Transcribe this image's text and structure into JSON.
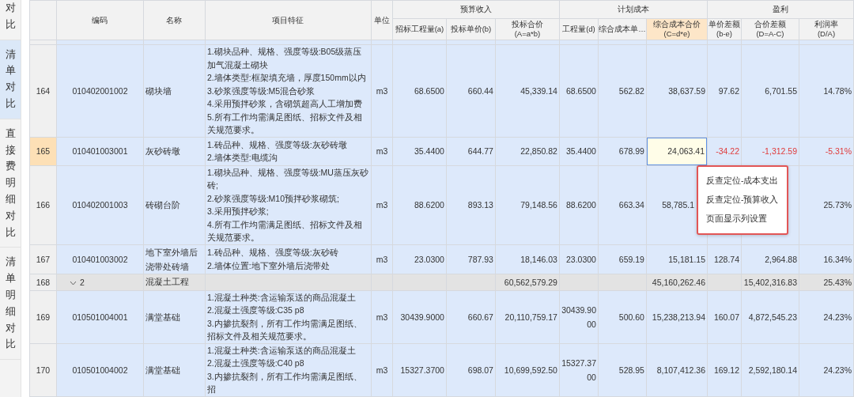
{
  "sidebar": {
    "tabs": [
      {
        "label": "对比",
        "selected": false
      },
      {
        "label": "清单对比",
        "selected": true
      },
      {
        "label": "直接费明细对比",
        "selected": false
      },
      {
        "label": "清单明细对比",
        "selected": false
      }
    ]
  },
  "table": {
    "fixed_columns": [
      "编码",
      "名称",
      "项目特征",
      "单位"
    ],
    "column_groups": [
      {
        "label": "预算收入",
        "columns": [
          {
            "lines": [
              "招标工程量(a)"
            ],
            "highlighted": false
          },
          {
            "lines": [
              "投标单价(b)"
            ],
            "highlighted": false
          },
          {
            "lines": [
              "投标合价",
              "(A=a*b)"
            ],
            "highlighted": false
          }
        ]
      },
      {
        "label": "计划成本",
        "columns": [
          {
            "lines": [
              "工程量(d)"
            ],
            "highlighted": false
          },
          {
            "lines": [
              "综合成本单…"
            ],
            "highlighted": false
          },
          {
            "lines": [
              "综合成本合价",
              "(C=d*e)"
            ],
            "highlighted": true
          }
        ]
      },
      {
        "label": "盈利",
        "columns": [
          {
            "lines": [
              "单价差额",
              "(b-e)"
            ],
            "highlighted": false
          },
          {
            "lines": [
              "合价差额",
              "(D=A-C)"
            ],
            "highlighted": false
          },
          {
            "lines": [
              "利润率",
              "(D/A)"
            ],
            "highlighted": false
          }
        ]
      }
    ],
    "rows": [
      {
        "kind": "item",
        "number": "164",
        "code": "010402001002",
        "name": "砌块墙",
        "features": [
          "1.砌块品种、规格、强度等级:B05级蒸压加气混凝土砌块",
          "2.墙体类型:框架填充墙，厚度150mm以内",
          "3.砂浆强度等级:M5混合砂浆",
          "4.采用预拌砂浆，含砌筑超高人工增加费",
          "5.所有工作均需满足图纸、招标文件及相关规范要求。"
        ],
        "unit": "m3",
        "values": {
          "bid_qty": "68.6500",
          "bid_price": "660.44",
          "bid_total": "45,339.14",
          "cost_qty": "68.6500",
          "cost_unit_price": "562.82",
          "cost_total": "38,637.59",
          "unit_diff": "97.62",
          "total_diff": "6,701.55",
          "profit_rate": "14.78%"
        },
        "selected": false,
        "loss": false
      },
      {
        "kind": "item",
        "number": "165",
        "code": "010401003001",
        "name": "灰砂砖墩",
        "features": [
          "1.砖品种、规格、强度等级:灰砂砖墩",
          "2.墙体类型:电缆沟"
        ],
        "unit": "m3",
        "values": {
          "bid_qty": "35.4400",
          "bid_price": "644.77",
          "bid_total": "22,850.82",
          "cost_qty": "35.4400",
          "cost_unit_price": "678.99",
          "cost_total": "24,063.41",
          "unit_diff": "-34.22",
          "total_diff": "-1,312.59",
          "profit_rate": "-5.31%"
        },
        "selected": true,
        "loss": true
      },
      {
        "kind": "item",
        "number": "166",
        "code": "010402001003",
        "name": "砖砌台阶",
        "features": [
          "1.砌块品种、规格、强度等级:MU蒸压灰砂砖;",
          "2.砂浆强度等级:M10预拌砂浆砌筑;",
          "3.采用预拌砂浆;",
          "4.所有工作均需满足图纸、招标文件及相关规范要求。"
        ],
        "unit": "m3",
        "values": {
          "bid_qty": "88.6200",
          "bid_price": "893.13",
          "bid_total": "79,148.56",
          "cost_qty": "88.6200",
          "cost_unit_price": "663.34",
          "cost_total": "58,785.1",
          "profit_rate": "25.73%"
        },
        "selected": false,
        "loss": false
      },
      {
        "kind": "item",
        "number": "167",
        "code": "010401003002",
        "name": "地下室外墙后浇带处砖墙",
        "features": [
          "1.砖品种、规格、强度等级:灰砂砖",
          "2.墙体位置:地下室外墙后浇带处"
        ],
        "unit": "m3",
        "values": {
          "bid_qty": "23.0300",
          "bid_price": "787.93",
          "bid_total": "18,146.03",
          "cost_qty": "23.0300",
          "cost_unit_price": "659.19",
          "cost_total": "15,181.15",
          "unit_diff": "128.74",
          "total_diff": "2,964.88",
          "profit_rate": "16.34%"
        },
        "selected": false,
        "loss": false
      },
      {
        "kind": "group",
        "number": "168",
        "code": "2",
        "name": "混凝土工程",
        "expanded": true,
        "values": {
          "bid_total": "60,562,579.29",
          "cost_total": "45,160,262.46",
          "total_diff": "15,402,316.83",
          "profit_rate": "25.43%"
        },
        "selected": false,
        "loss": false
      },
      {
        "kind": "item",
        "number": "169",
        "code": "010501004001",
        "name": "满堂基础",
        "features": [
          "1.混凝土种类:含运输泵送的商品混凝土",
          "2.混凝土强度等级:C35 p8",
          "3.内掺抗裂剂，所有工作均需满足图纸、招标文件及相关规范要求。"
        ],
        "unit": "m3",
        "values": {
          "bid_qty": "30439.9000",
          "bid_price": "660.67",
          "bid_total": "20,110,759.17",
          "cost_qty": "30439.9000",
          "cost_unit_price": "500.60",
          "cost_total": "15,238,213.94",
          "unit_diff": "160.07",
          "total_diff": "4,872,545.23",
          "profit_rate": "24.23%"
        },
        "selected": false,
        "loss": false
      },
      {
        "kind": "item",
        "number": "170",
        "code": "010501004002",
        "name": "满堂基础",
        "features": [
          "1.混凝土种类:含运输泵送的商品混凝土",
          "2.混凝土强度等级:C40 p8",
          "3.内掺抗裂剂，所有工作均需满足图纸、招"
        ],
        "unit": "m3",
        "values": {
          "bid_qty": "15327.3700",
          "bid_price": "698.07",
          "bid_total": "10,699,592.50",
          "cost_qty": "15327.3700",
          "cost_unit_price": "528.95",
          "cost_total": "8,107,412.36",
          "unit_diff": "169.12",
          "total_diff": "2,592,180.14",
          "profit_rate": "24.23%"
        },
        "selected": false,
        "loss": false
      }
    ]
  },
  "context_menu": {
    "items": [
      "反查定位-成本支出",
      "反查定位-预算收入",
      "页面显示列设置"
    ]
  }
}
